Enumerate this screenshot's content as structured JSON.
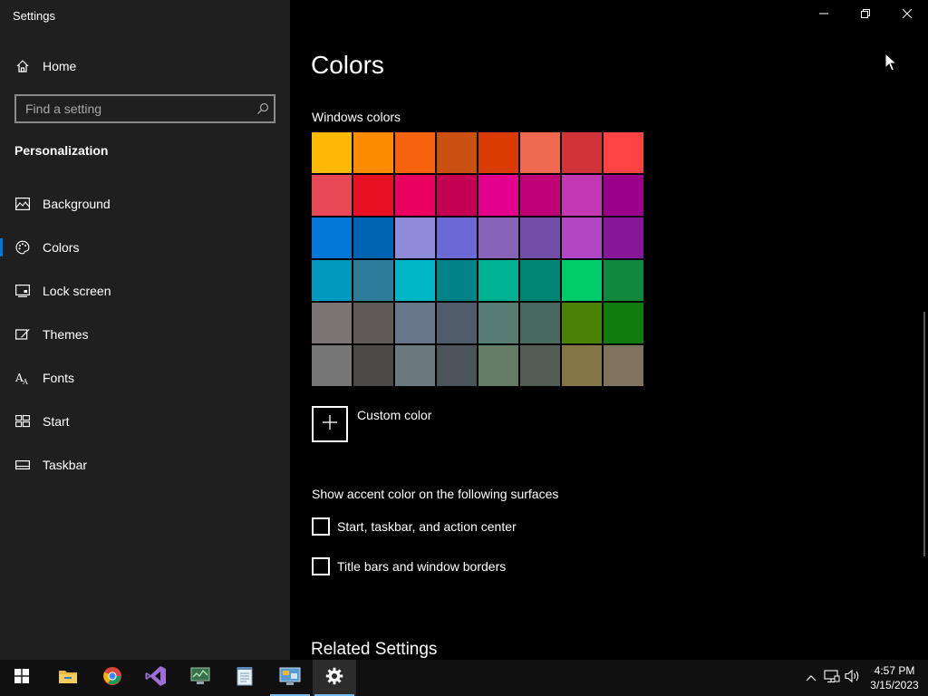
{
  "window": {
    "title": "Settings",
    "controls": [
      "minimize",
      "restore",
      "close"
    ]
  },
  "sidebar": {
    "home_label": "Home",
    "search": {
      "placeholder": "Find a setting",
      "value": ""
    },
    "section_title": "Personalization",
    "items": [
      {
        "label": "Background",
        "icon": "background-icon"
      },
      {
        "label": "Colors",
        "icon": "palette-icon",
        "active": true
      },
      {
        "label": "Lock screen",
        "icon": "lock-screen-icon"
      },
      {
        "label": "Themes",
        "icon": "themes-icon"
      },
      {
        "label": "Fonts",
        "icon": "fonts-icon"
      },
      {
        "label": "Start",
        "icon": "start-icon"
      },
      {
        "label": "Taskbar",
        "icon": "taskbar-icon"
      }
    ]
  },
  "main": {
    "title": "Colors",
    "windows_colors_label": "Windows colors",
    "swatches": [
      "#ffb900",
      "#ff8c00",
      "#f7630c",
      "#ca5010",
      "#da3b01",
      "#ef6950",
      "#d13438",
      "#ff4343",
      "#e74856",
      "#e81123",
      "#ea005e",
      "#c30052",
      "#e3008c",
      "#bf0077",
      "#c239b3",
      "#9a0089",
      "#0078d7",
      "#0063b1",
      "#8e8cd8",
      "#6b69d6",
      "#8764b8",
      "#744da9",
      "#b146c2",
      "#881798",
      "#0099bc",
      "#2d7d9a",
      "#00b7c3",
      "#038387",
      "#00b294",
      "#018574",
      "#00cc6a",
      "#10893e",
      "#7a7574",
      "#5d5a58",
      "#68768a",
      "#515c6b",
      "#567c73",
      "#486860",
      "#498205",
      "#107c10",
      "#767676",
      "#4c4a48",
      "#69797e",
      "#4a5459",
      "#647c64",
      "#525e54",
      "#847545",
      "#7e735f"
    ],
    "custom_color_label": "Custom color",
    "accent_surfaces_label": "Show accent color on the following surfaces",
    "checkboxes": [
      {
        "label": "Start, taskbar, and action center",
        "checked": false
      },
      {
        "label": "Title bars and window borders",
        "checked": false
      }
    ],
    "related_settings_label": "Related Settings"
  },
  "taskbar": {
    "apps": [
      "windows-start",
      "file-explorer",
      "chrome",
      "visual-studio",
      "task-manager",
      "notepad",
      "remote-desktop",
      "settings"
    ],
    "clock_time": "4:57 PM",
    "clock_date": "3/15/2023"
  }
}
